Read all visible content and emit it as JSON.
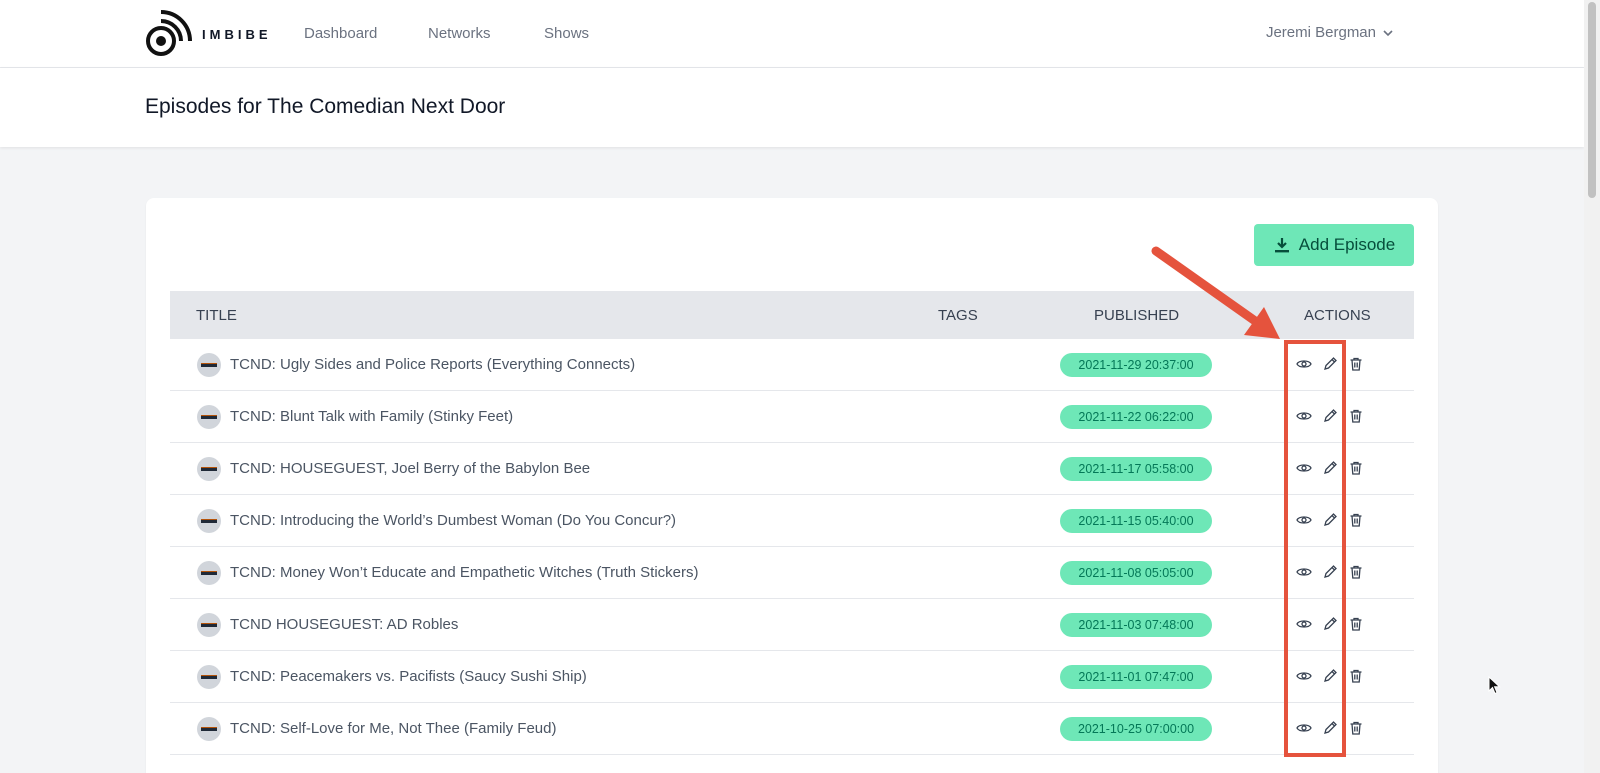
{
  "app": {
    "brand": "IMBIBE",
    "nav": [
      "Dashboard",
      "Networks",
      "Shows"
    ],
    "user": "Jeremi Bergman"
  },
  "page": {
    "title": "Episodes for The Comedian Next Door",
    "add_button": "Add Episode"
  },
  "table": {
    "headers": {
      "title": "TITLE",
      "tags": "TAGS",
      "published": "PUBLISHED",
      "actions": "ACTIONS"
    },
    "rows": [
      {
        "title": "TCND: Ugly Sides and Police Reports (Everything Connects)",
        "published": "2021-11-29 20:37:00"
      },
      {
        "title": "TCND: Blunt Talk with Family (Stinky Feet)",
        "published": "2021-11-22 06:22:00"
      },
      {
        "title": "TCND: HOUSEGUEST, Joel Berry of the Babylon Bee",
        "published": "2021-11-17 05:58:00"
      },
      {
        "title": "TCND: Introducing the World’s Dumbest Woman (Do You Concur?)",
        "published": "2021-11-15 05:40:00"
      },
      {
        "title": "TCND: Money Won’t Educate and Empathetic Witches (Truth Stickers)",
        "published": "2021-11-08 05:05:00"
      },
      {
        "title": "TCND HOUSEGUEST: AD Robles",
        "published": "2021-11-03 07:48:00"
      },
      {
        "title": "TCND: Peacemakers vs. Pacifists (Saucy Sushi Ship)",
        "published": "2021-11-01 07:47:00"
      },
      {
        "title": "TCND: Self-Love for Me, Not Thee (Family Feud)",
        "published": "2021-10-25 07:00:00"
      }
    ]
  },
  "colors": {
    "accent": "#6ee7b7",
    "accent_text": "#047857",
    "annotation": "#e5533d"
  },
  "icons": [
    "logo-icon",
    "chevron-down-icon",
    "download-icon",
    "eye-icon",
    "pencil-icon",
    "trash-icon"
  ]
}
